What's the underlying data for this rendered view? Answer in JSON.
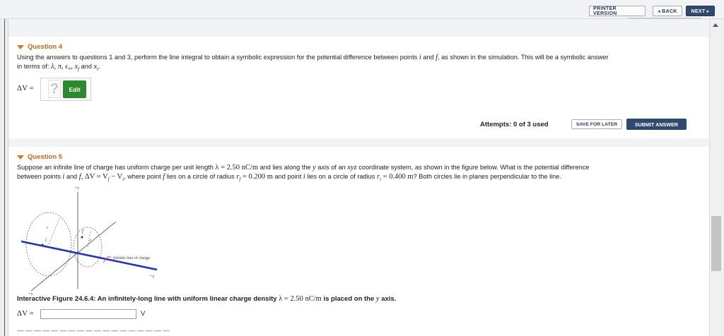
{
  "toolbar": {
    "printer_label": "PRINTER VERSION",
    "back_label": "◂ BACK",
    "next_label": "NEXT ▸"
  },
  "question4": {
    "title": "Question 4",
    "text_part1": "Using the answers to questions 1 and 3, perform the line integral to obtain a symbolic expression for the potential difference between points ",
    "var_i": "i",
    "and": " and ",
    "var_f": "f",
    "text_part2": ", as shown in the simulation. This will be a symbolic answer",
    "text_part3": "in terms of: ",
    "symbols": "λ, π, ϵ₀, x",
    "sub_f": "f",
    "and2": " and ",
    "x_i": "x",
    "sub_i": "i",
    "period": ".",
    "answer_label": "ΔV =",
    "placeholder_glyph": "?",
    "edit_label": "Edit",
    "attempts": "Attempts: 0 of 3 used",
    "save_label": "SAVE FOR LATER",
    "submit_label": "SUBMIT ANSWER"
  },
  "question5": {
    "title": "Question 5",
    "line1_a": "Suppose an infinite line of charge has uniform charge per unit length ",
    "lambda_expr": "λ = 2.50 nC/m",
    "line1_b": " and lies along the ",
    "y": "y",
    "line1_c": " axis of an ",
    "xyz": "xyz",
    "line1_d": " coordinate system, as shown in the figure below. What is the potential difference",
    "line2_a": "between points ",
    "i": "i",
    "and": " and ",
    "f": "f",
    "dv_expr": ", ΔV = V",
    "minus": " − V",
    "line2_b": ", where point ",
    "line2_c": " lies on a circle of radius ",
    "rf": "r",
    "rf_val": " = 0.200 m",
    "line2_d": " and point ",
    "line2_e": " lies on a circle of radius ",
    "ri": "r",
    "ri_val": " = 0.400 m",
    "line2_f": "? Both circles lie in planes perpendicular to the line.",
    "figure": {
      "axis_z": "+z",
      "axis_y": "+y",
      "axis_x": "+x",
      "label_ri": "r",
      "label_rf": "r",
      "label_f": "f",
      "label_i": "i",
      "line_label": "Infinite line of charge"
    },
    "caption_a": "Interactive Figure 24.6.4: An infinitely-long line with uniform linear charge density ",
    "caption_lambda": "λ = 2.50 nC/m",
    "caption_b": " is placed on the ",
    "caption_y": "y",
    "caption_c": " axis.",
    "answer_label": "ΔV =",
    "unit": "V",
    "cut_text": "— — — — — — — — — — — — — — — — — —"
  }
}
